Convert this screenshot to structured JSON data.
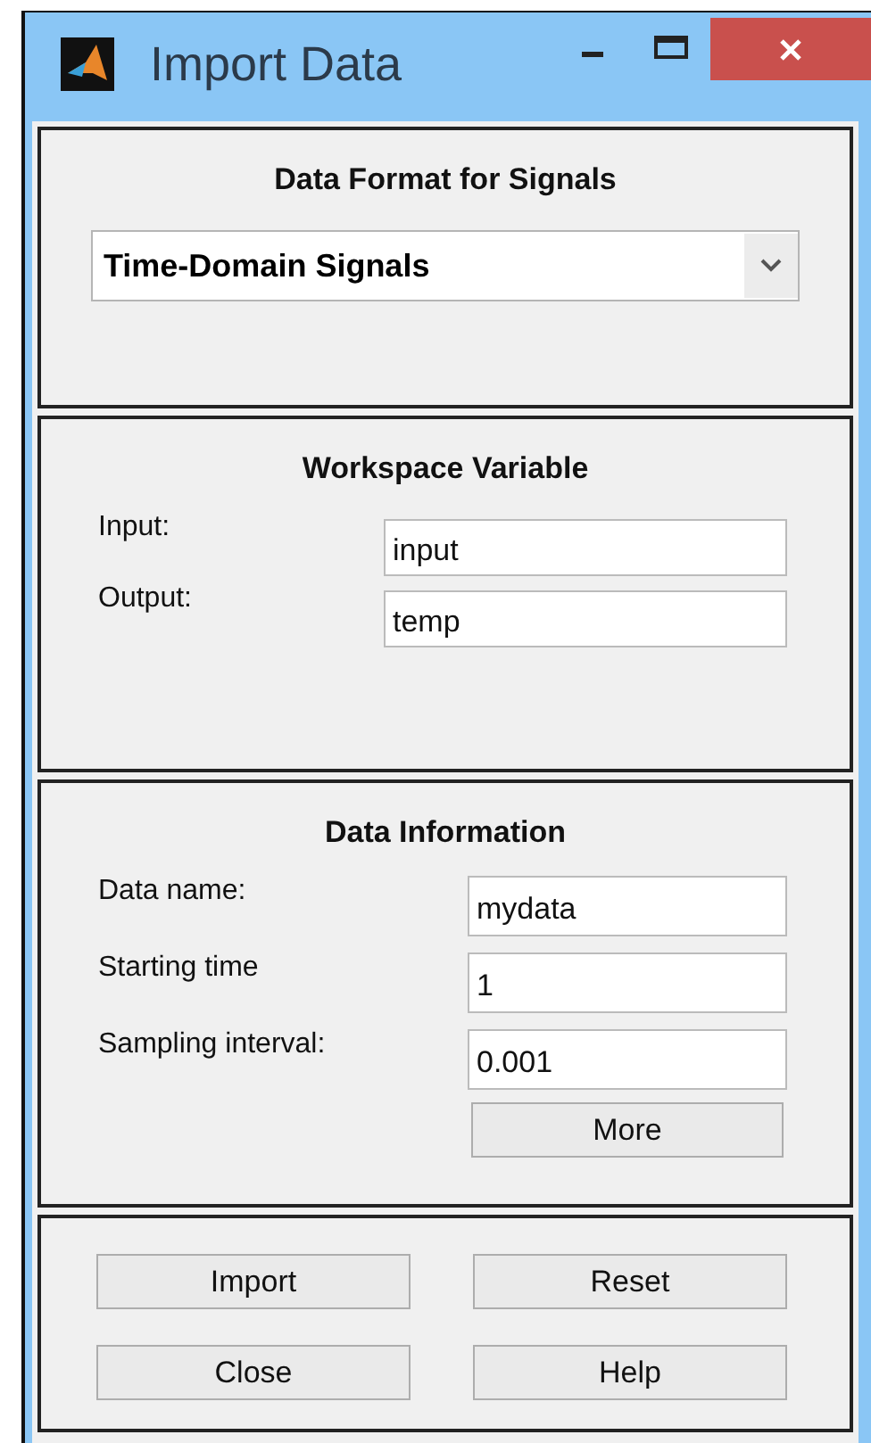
{
  "window": {
    "title": "Import Data"
  },
  "data_format": {
    "heading": "Data Format for Signals",
    "selection": "Time-Domain Signals"
  },
  "workspace_variable": {
    "heading": "Workspace Variable",
    "fields": [
      {
        "label": "Input:",
        "value": "input"
      },
      {
        "label": "Output:",
        "value": "temp"
      }
    ]
  },
  "data_information": {
    "heading": "Data Information",
    "fields": [
      {
        "label": "Data name:",
        "value": "mydata"
      },
      {
        "label": "Starting time",
        "value": "1"
      },
      {
        "label": "Sampling interval:",
        "value": "0.001"
      }
    ],
    "more_button": "More"
  },
  "buttons": [
    [
      "Import",
      "Reset"
    ],
    [
      "Close",
      "Help"
    ]
  ]
}
